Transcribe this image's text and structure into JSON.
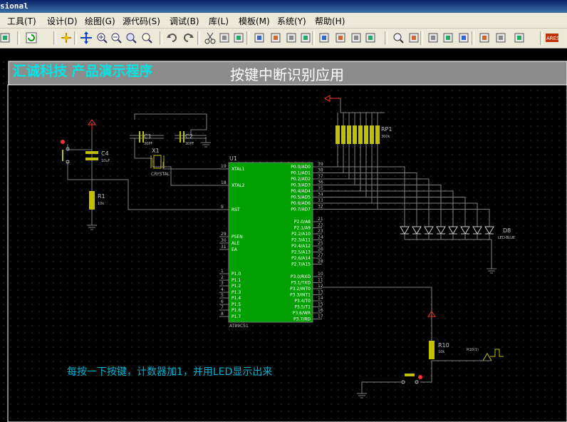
{
  "window": {
    "title": "sional"
  },
  "menu": [
    {
      "label": "工具(T)",
      "name": "menu-tools"
    },
    {
      "label": "设计(D)",
      "name": "menu-design"
    },
    {
      "label": "绘图(G)",
      "name": "menu-graph"
    },
    {
      "label": "源代码(S)",
      "name": "menu-source"
    },
    {
      "label": "调试(B)",
      "name": "menu-debug"
    },
    {
      "label": "库(L)",
      "name": "menu-library"
    },
    {
      "label": "模板(M)",
      "name": "menu-template"
    },
    {
      "label": "系统(Y)",
      "name": "menu-system"
    },
    {
      "label": "帮助(H)",
      "name": "menu-help"
    }
  ],
  "toolbar": {
    "icons": [
      "new-file-icon",
      "refresh-icon",
      "origin-icon",
      "pan-icon",
      "zoom-in-icon",
      "zoom-out-icon",
      "zoom-all-icon",
      "zoom-area-icon",
      "undo-icon",
      "redo-icon",
      "cut-icon",
      "copy-icon",
      "paste-icon",
      "block-copy-icon",
      "block-move-icon",
      "block-rotate-icon",
      "block-delete-icon",
      "pick-device-icon",
      "make-device-icon",
      "decompose-icon",
      "wire-autorouter-icon",
      "search-icon",
      "property-tool-icon",
      "new-sheet-icon",
      "remove-sheet-icon",
      "exit-parent-icon",
      "bill-of-materials-icon",
      "erc-icon",
      "netlist-to-ares-icon",
      "ares-icon"
    ],
    "ares_label": "ARES"
  },
  "colors": {
    "canvas_bg": "#000000",
    "wire": "#7f7f7f",
    "component": "#c0c000",
    "chip_fill": "#00a000",
    "title_cyan": "#00e5e5",
    "power_red": "#ff3030"
  },
  "schematic": {
    "banner": {
      "company": "汇诚科技 产品演示程序",
      "title": "按键中断识别应用"
    },
    "note": "每按一下按键，计数器加1，并用LED显示出来",
    "u1": {
      "ref": "U1",
      "part": "AT89C51",
      "left_pins": [
        {
          "num": "19",
          "name": "XTAL1"
        },
        {
          "num": "18",
          "name": "XTAL2"
        },
        {
          "num": "9",
          "name": "RST"
        },
        {
          "num": "29",
          "name": "PSEN"
        },
        {
          "num": "30",
          "name": "ALE"
        },
        {
          "num": "31",
          "name": "EA"
        },
        {
          "num": "1",
          "name": "P1.0"
        },
        {
          "num": "2",
          "name": "P1.1"
        },
        {
          "num": "3",
          "name": "P1.2"
        },
        {
          "num": "4",
          "name": "P1.3"
        },
        {
          "num": "5",
          "name": "P1.4"
        },
        {
          "num": "6",
          "name": "P1.5"
        },
        {
          "num": "7",
          "name": "P1.6"
        },
        {
          "num": "8",
          "name": "P1.7"
        }
      ],
      "right_pins_p0": [
        {
          "num": "39",
          "name": "P0.0/AD0"
        },
        {
          "num": "38",
          "name": "P0.1/AD1"
        },
        {
          "num": "37",
          "name": "P0.2/AD2"
        },
        {
          "num": "36",
          "name": "P0.3/AD3"
        },
        {
          "num": "35",
          "name": "P0.4/AD4"
        },
        {
          "num": "34",
          "name": "P0.5/AD5"
        },
        {
          "num": "33",
          "name": "P0.6/AD6"
        },
        {
          "num": "32",
          "name": "P0.7/AD7"
        }
      ],
      "right_pins_p2": [
        {
          "num": "21",
          "name": "P2.0/A8"
        },
        {
          "num": "22",
          "name": "P2.1/A9"
        },
        {
          "num": "23",
          "name": "P2.2/A10"
        },
        {
          "num": "24",
          "name": "P2.3/A11"
        },
        {
          "num": "25",
          "name": "P2.4/A12"
        },
        {
          "num": "26",
          "name": "P2.5/A13"
        },
        {
          "num": "27",
          "name": "P2.6/A14"
        },
        {
          "num": "28",
          "name": "P2.7/A15"
        }
      ],
      "right_pins_p3": [
        {
          "num": "10",
          "name": "P3.0/RXD"
        },
        {
          "num": "11",
          "name": "P3.1/TXD"
        },
        {
          "num": "12",
          "name": "P3.2/INT0"
        },
        {
          "num": "13",
          "name": "P3.3/INT1"
        },
        {
          "num": "14",
          "name": "P3.4/T0"
        },
        {
          "num": "15",
          "name": "P3.5/T1"
        },
        {
          "num": "16",
          "name": "P3.6/WR"
        },
        {
          "num": "17",
          "name": "P3.7/RD"
        }
      ]
    },
    "c1": {
      "ref": "C1",
      "value": "30PF"
    },
    "c2": {
      "ref": "C2",
      "value": "30PF"
    },
    "c4": {
      "ref": "C4",
      "value": "10uF"
    },
    "x1": {
      "ref": "X1",
      "value": "CRYSTAL"
    },
    "r1": {
      "ref": "R1",
      "value": "10k"
    },
    "rp1": {
      "ref": "RP1",
      "value": "300k"
    },
    "d8": {
      "ref": "D8",
      "value": "LED-BLUE"
    },
    "r10": {
      "ref": "R10",
      "value": "10k"
    },
    "probe": {
      "label": "R10(1)"
    }
  }
}
